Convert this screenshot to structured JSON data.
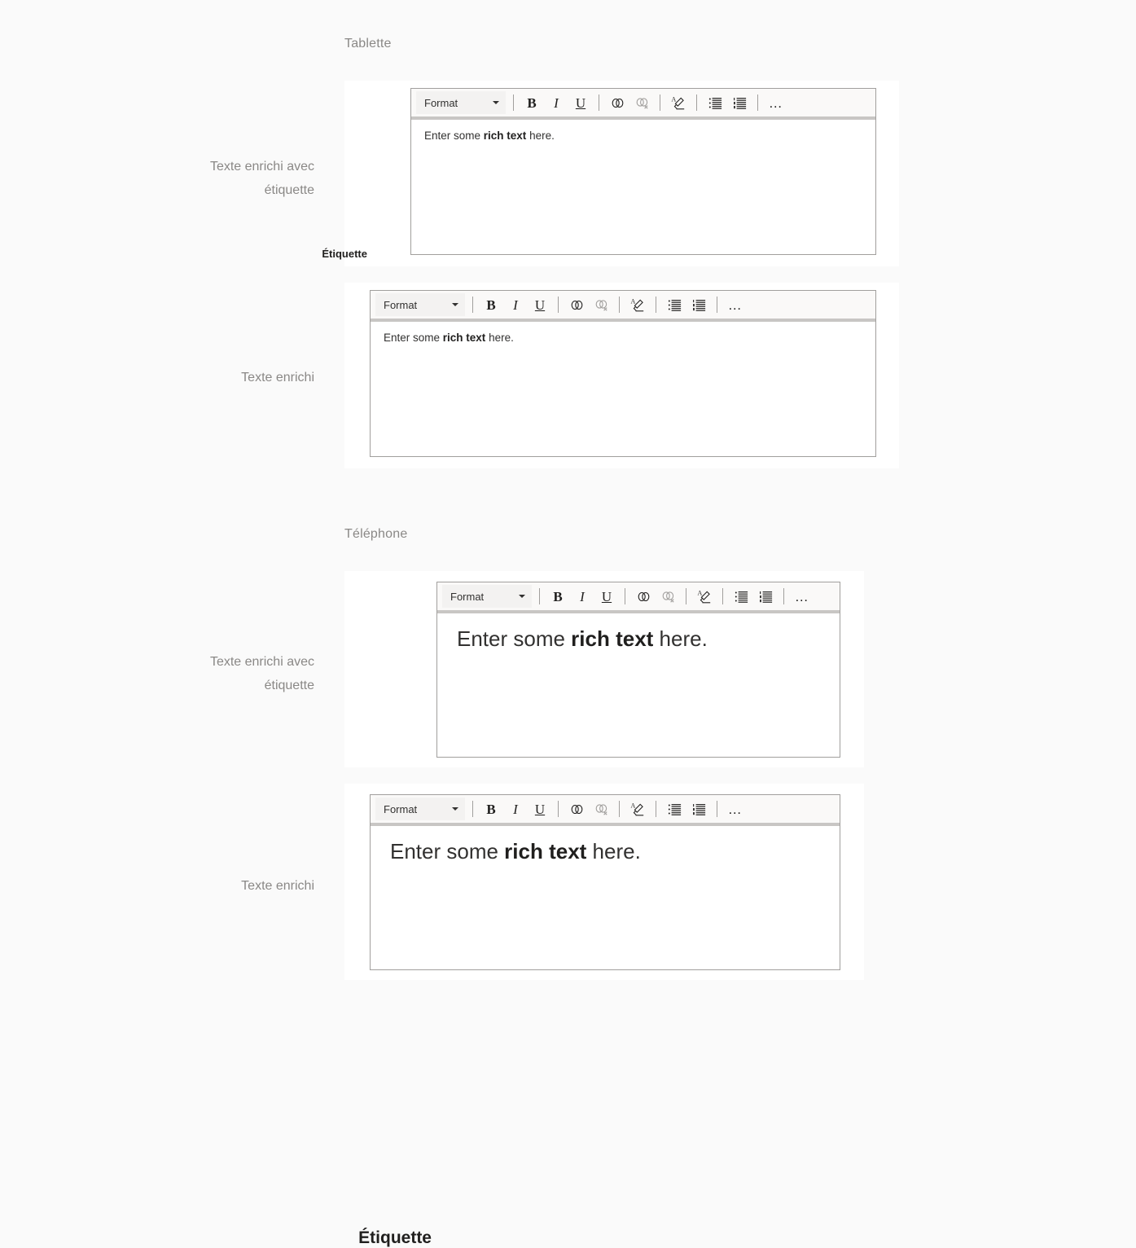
{
  "sections": [
    {
      "id": "tablet",
      "heading": "Tablette"
    },
    {
      "id": "phone",
      "heading": "Téléphone"
    }
  ],
  "rows": [
    {
      "id": "tablet-labeled",
      "description": "Texte enrichi avec\nétiquette",
      "field_label": "Étiquette",
      "has_label": true
    },
    {
      "id": "tablet-plain",
      "description": "Texte enrichi",
      "field_label": "",
      "has_label": false
    },
    {
      "id": "phone-labeled",
      "description": "Texte enrichi avec\nétiquette",
      "field_label": "Étiquette",
      "has_label": true
    },
    {
      "id": "phone-plain",
      "description": "Texte enrichi",
      "field_label": "",
      "has_label": false
    }
  ],
  "editor": {
    "format_select_label": "Format",
    "caret_icon": "chevron-down-icon",
    "buttons": [
      {
        "name": "bold-button",
        "label": "B",
        "icon": "bold-icon",
        "disabled": false
      },
      {
        "name": "italic-button",
        "label": "I",
        "icon": "italic-icon",
        "disabled": false
      },
      {
        "name": "underline-button",
        "label": "U",
        "icon": "underline-icon",
        "disabled": false
      },
      {
        "name": "insert-link-button",
        "label": "",
        "icon": "link-icon",
        "disabled": false
      },
      {
        "name": "remove-link-button",
        "label": "",
        "icon": "unlink-icon",
        "disabled": true
      },
      {
        "name": "clear-formatting-button",
        "label": "",
        "icon": "clear-formatting-icon",
        "disabled": false
      },
      {
        "name": "bulleted-list-button",
        "label": "",
        "icon": "bulleted-list-icon",
        "disabled": false
      },
      {
        "name": "numbered-list-button",
        "label": "",
        "icon": "numbered-list-icon",
        "disabled": false
      },
      {
        "name": "more-options-button",
        "label": "…",
        "icon": "ellipsis-icon",
        "disabled": false
      }
    ],
    "content": {
      "before": "Enter some ",
      "bold": "rich text",
      "after": " here."
    }
  },
  "colors": {
    "page_background": "#fafafa",
    "card_background": "#ffffff",
    "toolbar_background": "#faf9f8",
    "format_select_background": "#f3f2f1",
    "editor_border": "#a19f9d",
    "toolbar_underline": "#c8c6c4",
    "description_text": "#8a8886",
    "body_text": "#323130",
    "label_text": "#201f1e",
    "disabled_icon": "#a19f9d"
  }
}
